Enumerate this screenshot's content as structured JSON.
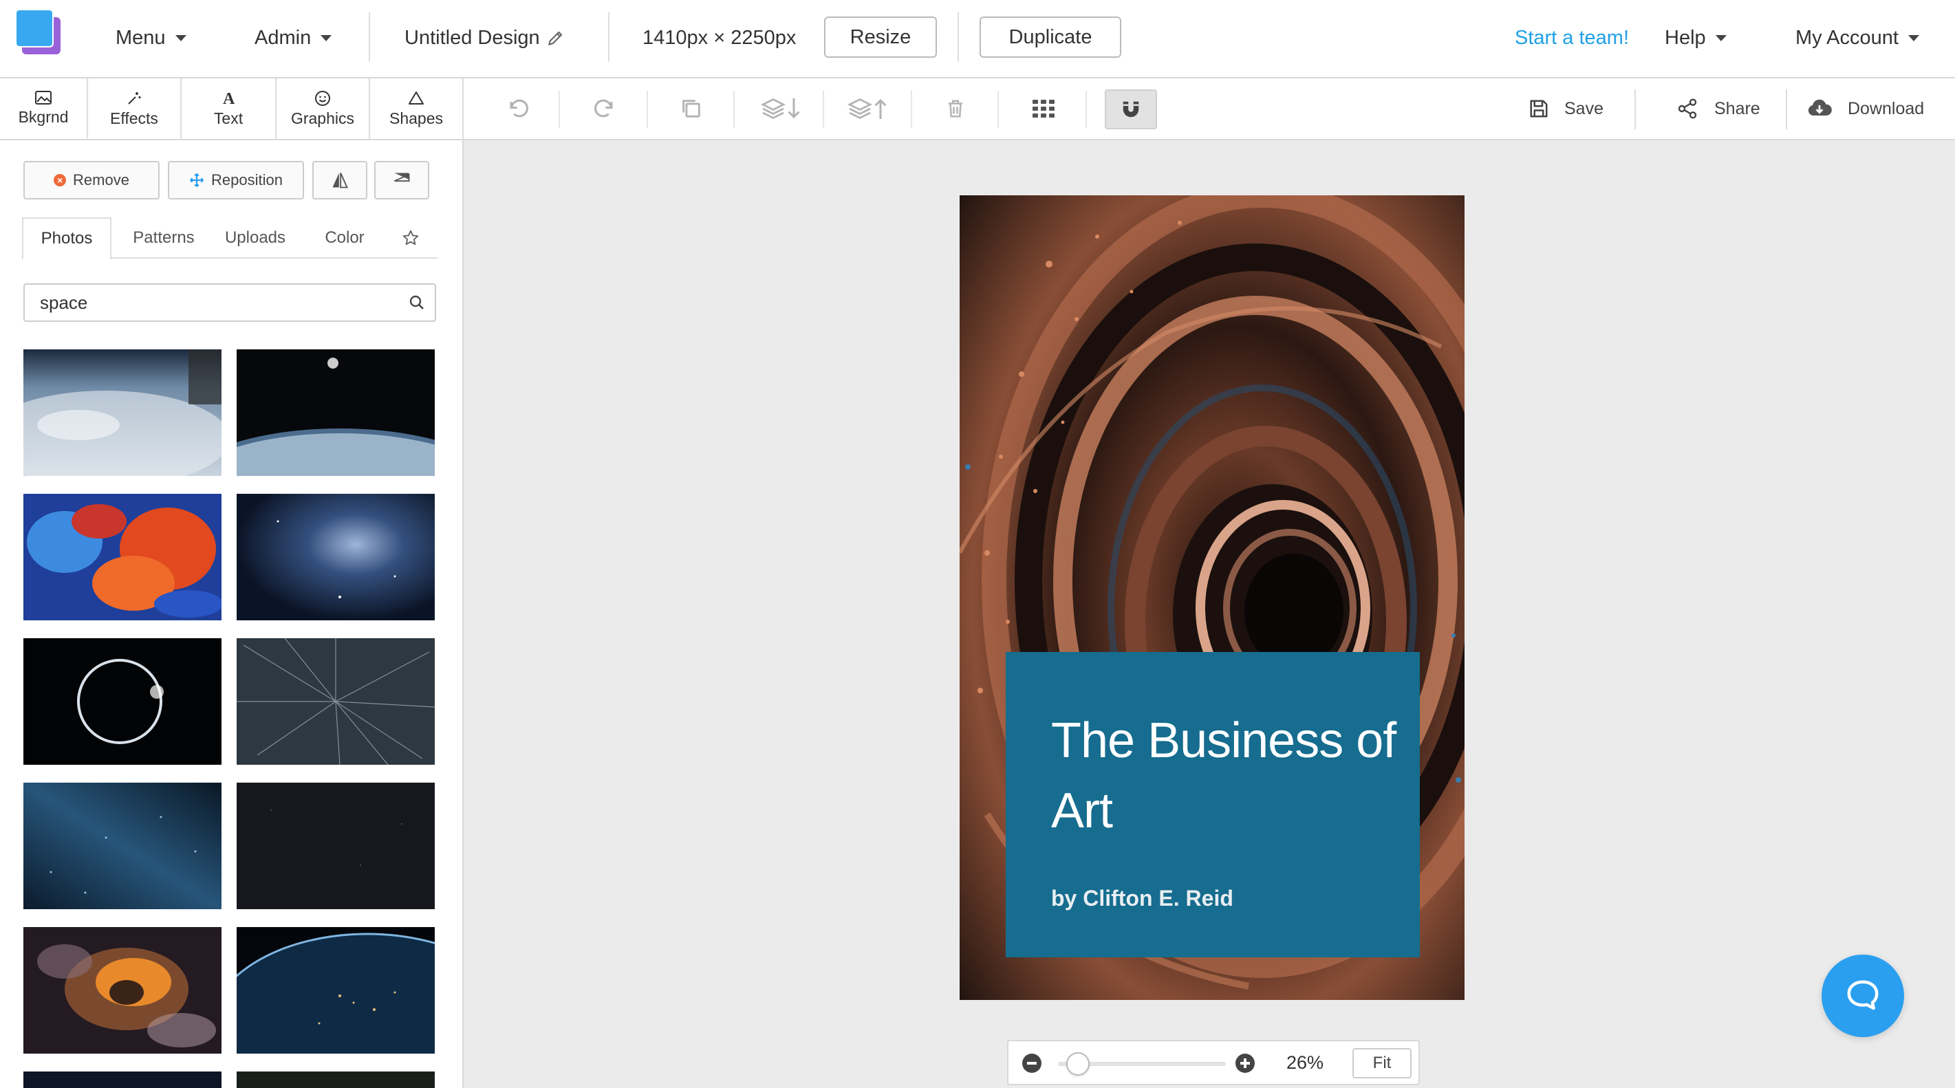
{
  "header": {
    "menu_label": "Menu",
    "admin_label": "Admin",
    "design_title": "Untitled Design",
    "dimensions": "1410px × 2250px",
    "resize_label": "Resize",
    "duplicate_label": "Duplicate",
    "team_link": "Start a team!",
    "help_label": "Help",
    "account_label": "My Account"
  },
  "tool_tabs": [
    {
      "label": "Bkgrnd",
      "icon": "image-icon"
    },
    {
      "label": "Effects",
      "icon": "wand-icon"
    },
    {
      "label": "Text",
      "icon": "text-icon"
    },
    {
      "label": "Graphics",
      "icon": "smiley-icon"
    },
    {
      "label": "Shapes",
      "icon": "triangle-icon"
    }
  ],
  "toolbar": {
    "icons": [
      "undo-icon",
      "redo-icon",
      "copy-icon",
      "layer-down-icon",
      "layer-up-icon",
      "trash-icon",
      "grid-icon",
      "magnet-icon"
    ],
    "save_label": "Save",
    "share_label": "Share",
    "download_label": "Download"
  },
  "panel": {
    "remove_label": "Remove",
    "reposition_label": "Reposition",
    "subtabs": [
      "Photos",
      "Patterns",
      "Uploads",
      "Color"
    ],
    "search_value": "space",
    "thumbnails": [
      "earth-from-orbit",
      "astronaut-over-earth",
      "colorful-smoke",
      "milky-way",
      "solar-eclipse",
      "star-streaks",
      "blue-star-field",
      "dark-night-sky",
      "orange-nebula",
      "earth-night-lights",
      "night-sky-dark",
      "dark-forest-sky"
    ]
  },
  "canvas": {
    "book_title": "The Business of Art",
    "book_author": "by Clifton E. Reid",
    "title_box_color": "#166d8f"
  },
  "zoom": {
    "percent": "26%",
    "fit_label": "Fit",
    "level": 0.26
  },
  "colors": {
    "accent": "#1ea0e6",
    "chat_button": "#2a9ff0",
    "logo_front": "#38a9f0",
    "logo_back": "#9a62d8"
  }
}
